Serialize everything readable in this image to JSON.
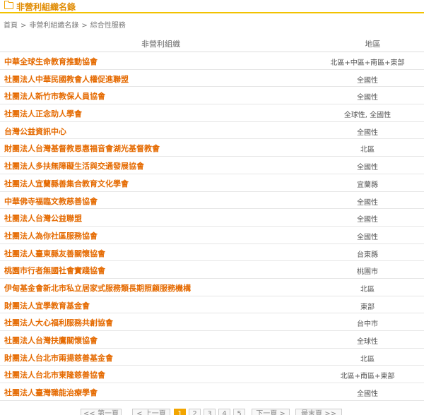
{
  "header": {
    "title": "非營利組織名錄"
  },
  "breadcrumb": [
    "首頁",
    "非營利組織名錄",
    "綜合性服務"
  ],
  "table": {
    "columns": [
      "非營利組織",
      "地區"
    ],
    "rows": [
      {
        "name": "中華全球生命教育推動協會",
        "region": "北區+中區+南區+東部"
      },
      {
        "name": "社團法人中華民國教會人權促進聯盟",
        "region": "全國性"
      },
      {
        "name": "社團法人新竹市教保人員協會",
        "region": "全國性"
      },
      {
        "name": "社團法人正念助人學會",
        "region": "全球性, 全國性"
      },
      {
        "name": "台灣公益資訊中心",
        "region": "全國性"
      },
      {
        "name": "財團法人台灣基督教恩惠福音會湖光基督教會",
        "region": "北區"
      },
      {
        "name": "社團法人多扶無障礙生活與交通發展協會",
        "region": "全國性"
      },
      {
        "name": "社團法人宜蘭縣善集合教育文化學會",
        "region": "宜蘭縣"
      },
      {
        "name": "中華佛寺福臨文教慈善協會",
        "region": "全國性"
      },
      {
        "name": "社團法人台灣公益聯盟",
        "region": "全國性"
      },
      {
        "name": "社團法人為你社區服務協會",
        "region": "全國性"
      },
      {
        "name": "社團法人臺東縣友善關懷協會",
        "region": "台東縣"
      },
      {
        "name": "桃園市行者無國社會實踐協會",
        "region": "桃園市"
      },
      {
        "name": "伊甸基金會新北市私立居家式服務類長期照顧服務機構",
        "region": "北區"
      },
      {
        "name": "財團法人宜學教育基金會",
        "region": "東部"
      },
      {
        "name": "社團法人大心福利服務共創協會",
        "region": "台中市"
      },
      {
        "name": "社團法人台灣扶鷹關懷協會",
        "region": "全球性"
      },
      {
        "name": "財團法人台北市兩揚慈善基金會",
        "region": "北區"
      },
      {
        "name": "社團法人台北市東隆慈善協會",
        "region": "北區+南區+東部"
      },
      {
        "name": "社團法人臺灣職能治療學會",
        "region": "全國性"
      }
    ]
  },
  "pager": {
    "first": "<< 第一頁",
    "prev": "< 上一頁",
    "pages": [
      "1",
      "2",
      "3",
      "4",
      "5"
    ],
    "current": "1",
    "next": "下一頁 >",
    "last": "最末頁 >>"
  }
}
